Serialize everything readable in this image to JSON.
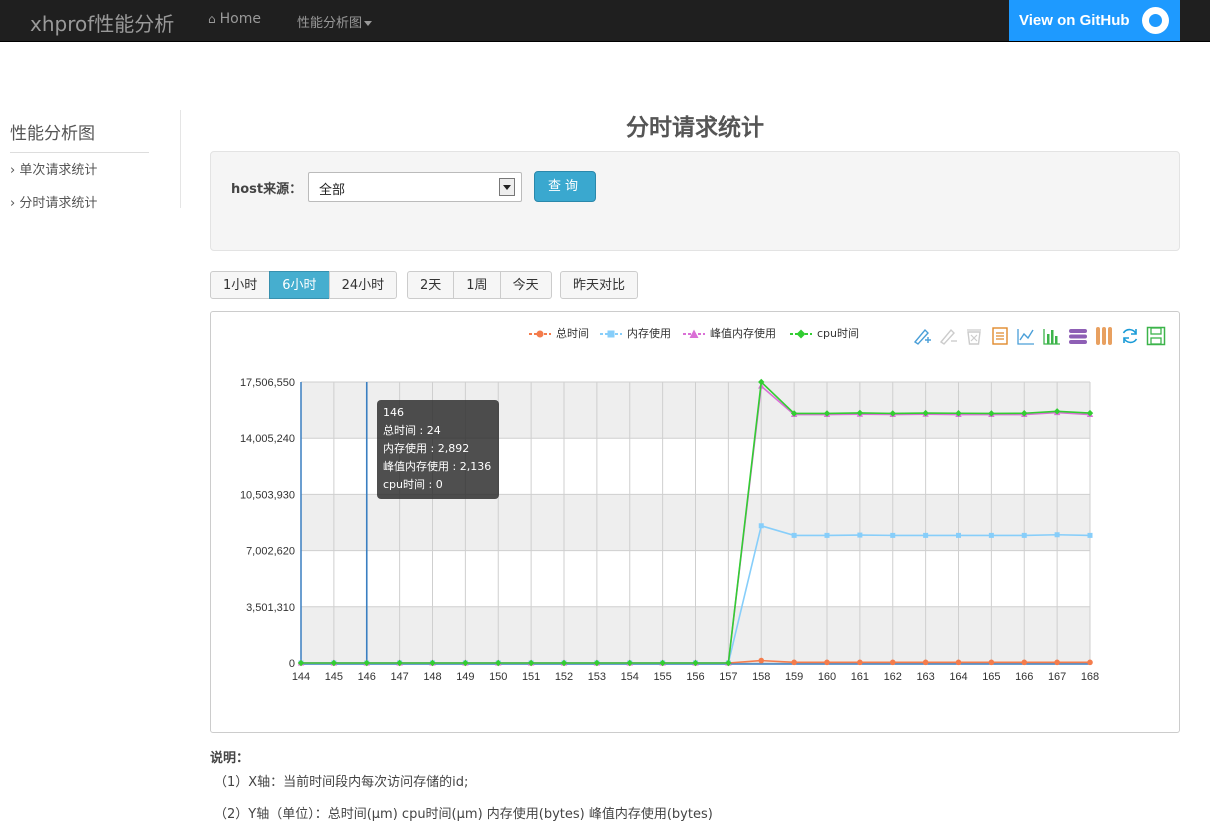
{
  "nav": {
    "brand": "xhprof性能分析",
    "home_label": "Home",
    "dropdown_label": "性能分析图",
    "github_label": "View on GitHub"
  },
  "sidebar": {
    "title": "性能分析图",
    "items": [
      {
        "label": "单次请求统计"
      },
      {
        "label": "分时请求统计"
      }
    ]
  },
  "page": {
    "title": "分时请求统计"
  },
  "filter": {
    "host_label": "host来源：",
    "host_value": "全部",
    "query_label": "查询"
  },
  "ranges": {
    "group1": [
      "1小时",
      "6小时",
      "24小时"
    ],
    "group2": [
      "2天",
      "1周",
      "今天"
    ],
    "group3": [
      "昨天对比"
    ],
    "active": "6小时"
  },
  "tooltip": {
    "title": "146",
    "lines": [
      "总时间 : 24",
      "内存使用 : 2,892",
      "峰值内存使用 : 2,136",
      "cpu时间 : 0"
    ]
  },
  "notes": {
    "title": "说明：",
    "line1": "（1）X轴：当前时间段内每次访问存储的id;",
    "line2": "（2）Y轴（单位）：总时间(μm) cpu时间(μm) 内存使用(bytes) 峰值内存使用(bytes)"
  },
  "chart_data": {
    "type": "line",
    "categories": [
      "144",
      "145",
      "146",
      "147",
      "148",
      "149",
      "150",
      "151",
      "152",
      "153",
      "154",
      "155",
      "156",
      "157",
      "158",
      "159",
      "160",
      "161",
      "162",
      "163",
      "164",
      "165",
      "166",
      "167",
      "168"
    ],
    "ylim": [
      0,
      17506550
    ],
    "yticks": [
      "0",
      "3,501,310",
      "7,002,620",
      "10,503,930",
      "14,005,240",
      "17,506,550"
    ],
    "highlight_category": "146",
    "series": [
      {
        "name": "总时间",
        "color": "#f47c4c",
        "marker": "circle",
        "values": [
          24,
          24,
          24,
          24,
          24,
          24,
          24,
          24,
          24,
          24,
          24,
          24,
          24,
          24,
          150000,
          40000,
          40000,
          40000,
          40000,
          40000,
          40000,
          40000,
          40000,
          40000,
          40000
        ]
      },
      {
        "name": "内存使用",
        "color": "#87cefa",
        "marker": "square",
        "values": [
          2892,
          2892,
          2892,
          2892,
          2892,
          2892,
          2892,
          2892,
          2892,
          2892,
          2892,
          2892,
          2892,
          2892,
          8550000,
          7950000,
          7950000,
          7970000,
          7950000,
          7950000,
          7950000,
          7950000,
          7950000,
          7990000,
          7950000
        ]
      },
      {
        "name": "峰值内存使用",
        "color": "#da70d6",
        "marker": "triangle",
        "values": [
          2136,
          2136,
          2136,
          2136,
          2136,
          2136,
          2136,
          2136,
          2136,
          2136,
          2136,
          2136,
          2136,
          2136,
          17250000,
          15480000,
          15480000,
          15500000,
          15480000,
          15500000,
          15480000,
          15480000,
          15480000,
          15600000,
          15480000
        ]
      },
      {
        "name": "cpu时间",
        "color": "#32cd32",
        "marker": "diamond",
        "values": [
          0,
          0,
          0,
          0,
          0,
          0,
          0,
          0,
          0,
          0,
          0,
          0,
          0,
          0,
          17506550,
          15550000,
          15550000,
          15580000,
          15550000,
          15570000,
          15560000,
          15550000,
          15560000,
          15680000,
          15570000
        ]
      }
    ]
  }
}
